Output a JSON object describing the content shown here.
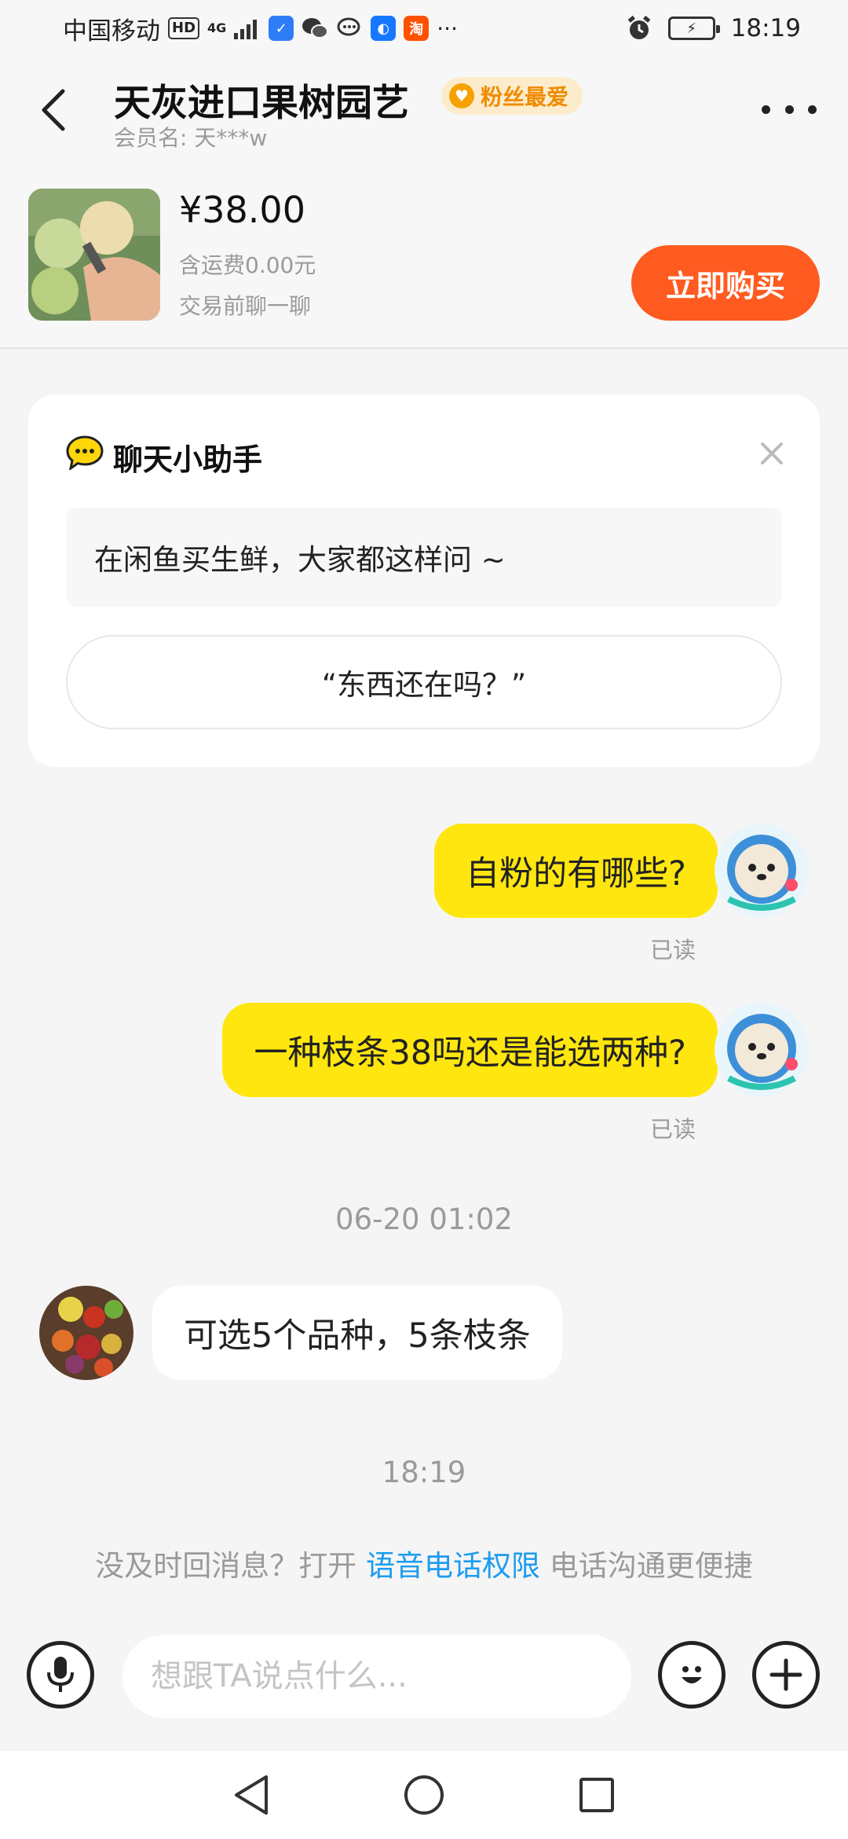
{
  "status_bar": {
    "carrier": "中国移动",
    "hd": "HD",
    "network": "4G",
    "time": "18:19",
    "app_icon_text": "淘"
  },
  "header": {
    "shop_name": "天灰进口果树园艺",
    "fan_badge": "粉丝最爱",
    "member_label": "会员名: 天***w"
  },
  "product": {
    "price": "¥38.00",
    "shipping": "含运费0.00元",
    "note": "交易前聊一聊",
    "buy_label": "立即购买"
  },
  "assistant": {
    "title": "聊天小助手",
    "tip": "在闲鱼买生鲜，大家都这样问 ~",
    "suggestion": "“东西还在吗？”"
  },
  "messages": [
    {
      "from": "me",
      "text": "自粉的有哪些?",
      "status": "已读"
    },
    {
      "from": "me",
      "text": "一种枝条38吗还是能选两种?",
      "status": "已读"
    },
    {
      "from": "them",
      "text": "可选5个品种，5条枝条"
    }
  ],
  "timestamps": [
    "06-20 01:02",
    "18:19"
  ],
  "notice": {
    "prefix": "没及时回消息？打开 ",
    "link": "语音电话权限",
    "suffix": " 电话沟通更便捷"
  },
  "input": {
    "placeholder": "想跟TA说点什么..."
  },
  "colors": {
    "accent_yellow": "#ffe60f",
    "buy_orange": "#ff5a1f",
    "link_blue": "#1a9cf0",
    "badge_orange": "#f08c00"
  }
}
